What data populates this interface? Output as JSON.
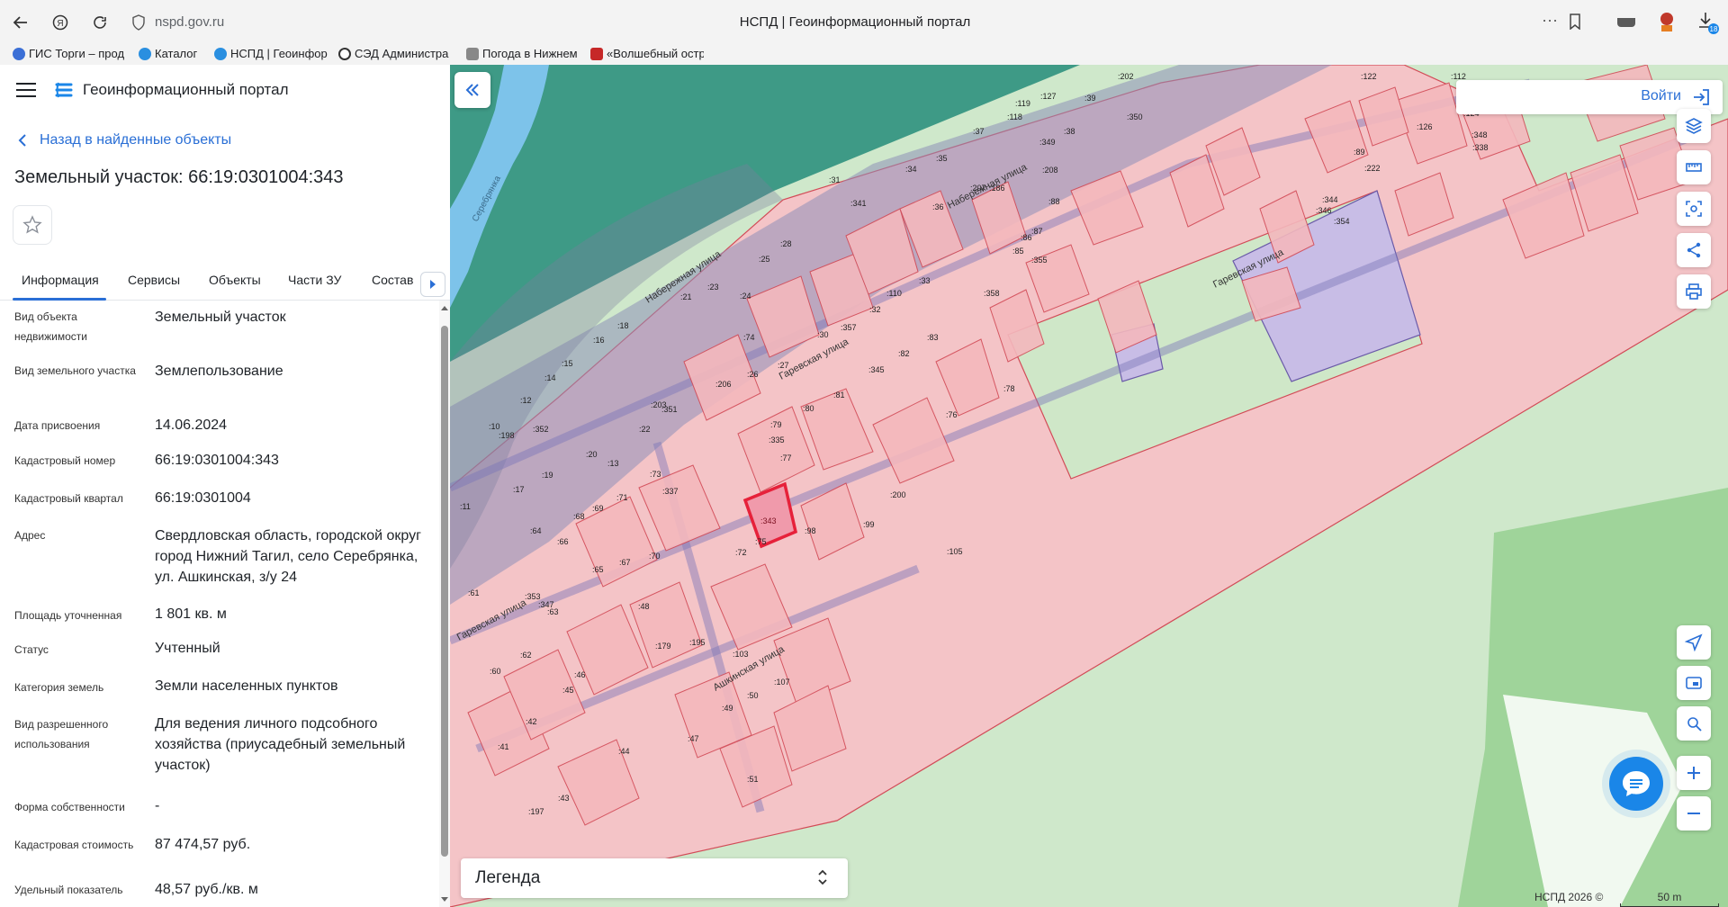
{
  "browser": {
    "url": "nspd.gov.ru",
    "tab_title": "НСПД | Геоинформационный портал",
    "bookmarks": [
      {
        "label": "ГИС Торги – прод",
        "color": "#3b6fd6"
      },
      {
        "label": "Каталог",
        "color": "#2a8fe0"
      },
      {
        "label": "НСПД | Геоинфор",
        "color": "#2a8fe0"
      },
      {
        "label": "СЭД Администра",
        "color": "#333333"
      },
      {
        "label": "Погода в Нижнем",
        "color": "#888888"
      },
      {
        "label": "«Волшебный остр",
        "color": "#c62828"
      }
    ]
  },
  "header": {
    "portal_title": "Геоинформационный портал",
    "back_link": "Назад в найденные объекты",
    "page_title": "Земельный участок: 66:19:0301004:343"
  },
  "tabs": [
    "Информация",
    "Сервисы",
    "Объекты",
    "Части ЗУ",
    "Состав"
  ],
  "properties": [
    {
      "label": "Вид объекта недвижимости",
      "value": "Земельный участок"
    },
    {
      "label": "Вид земельного участка",
      "value": "Землепользование"
    },
    {
      "label": "Дата присвоения",
      "value": "14.06.2024"
    },
    {
      "label": "Кадастровый номер",
      "value": "66:19:0301004:343"
    },
    {
      "label": "Кадастровый квартал",
      "value": "66:19:0301004"
    },
    {
      "label": "Адрес",
      "value": "Свердловская область, городской округ город Нижний Тагил, село Серебрянка, ул. Ашкинская, з/у 24"
    },
    {
      "label": "Площадь уточненная",
      "value": "1 801 кв. м"
    },
    {
      "label": "Статус",
      "value": "Учтенный"
    },
    {
      "label": "Категория земель",
      "value": "Земли населенных пунктов"
    },
    {
      "label": "Вид разрешенного использования",
      "value": "Для ведения личного подсобного хозяйства (приусадебный земельный участок)"
    },
    {
      "label": "Форма собственности",
      "value": "-"
    },
    {
      "label": "Кадастровая стоимость",
      "value": "87 474,57 руб."
    },
    {
      "label": "Удельный показатель",
      "value": "48,57 руб./кв. м"
    }
  ],
  "map": {
    "login_label": "Войти",
    "legend_label": "Легенда",
    "copyright": "НСПД 2026 ©",
    "scale": "50 m",
    "river_label": "Серебрянка",
    "streets": [
      "Набережная улица",
      "Набережная улица",
      "Гаревская улица",
      "Гаревская улица",
      "Гаревская улица",
      "Ашкинская улица"
    ],
    "parcel_labels": [
      ":202",
      ":122",
      ":112",
      ":119",
      ":127",
      ":39",
      ":118",
      ":37",
      ":350",
      ":38",
      ":349",
      ":124",
      ":126",
      ":348",
      ":338",
      ":89",
      ":35",
      ":34",
      ":186",
      ":208",
      ":207",
      ":222",
      ":344",
      ":346",
      ":354",
      ":36",
      ":88",
      ":31",
      ":341",
      ":28",
      ":25",
      ":87",
      ":86",
      ":85",
      ":355",
      ":33",
      ":110",
      ":23",
      ":24",
      ":21",
      ":358",
      ":357",
      ":32",
      ":18",
      ":30",
      ":74",
      ":16",
      ":83",
      ":82",
      ":345",
      ":27",
      ":15",
      ":14",
      ":206",
      ":26",
      ":81",
      ":78",
      ":12",
      ":203",
      ":351",
      ":80",
      ":76",
      ":10",
      ":198",
      ":352",
      ":79",
      ":335",
      ":22",
      ":20",
      ":13",
      ":77",
      ":19",
      ":17",
      ":73",
      ":337",
      ":200",
      ":71",
      ":69",
      ":68",
      ":99",
      ":98",
      ":75",
      ":72",
      ":105",
      ":11",
      ":64",
      ":66",
      ":70",
      ":67",
      ":65",
      ":61",
      ":353",
      ":347",
      ":63",
      ":48",
      ":343",
      ":103",
      ":179",
      ":195",
      ":62",
      ":60",
      ":46",
      ":45",
      ":107",
      ":50",
      ":49",
      ":42",
      ":47",
      ":41",
      ":44",
      ":51",
      ":43",
      ":197"
    ],
    "colors": {
      "selected": "#e6213a",
      "accent": "#2a6fd6",
      "parcel": "#f4b8bd"
    }
  }
}
